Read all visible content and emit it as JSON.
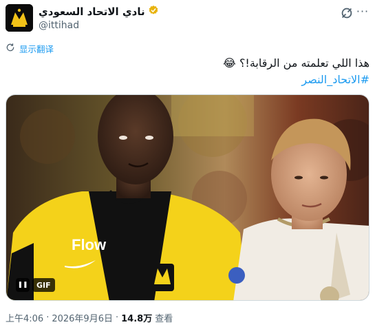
{
  "author": {
    "display_name": "نادي الاتحاد السعودي",
    "handle": "@ittihad",
    "verified": true,
    "verified_color": "#e8b30e"
  },
  "translate": {
    "label": "显示翻译"
  },
  "tweet": {
    "text": "هذا اللي تعلمته من الرقابة!؟ 😂",
    "hashtag": "#الاتحاد_النصر"
  },
  "media": {
    "type": "GIF",
    "badge": "GIF",
    "pause_icon": "pause-icon",
    "jersey_sponsor": "Flow"
  },
  "meta": {
    "time": "上午4:06",
    "separator": "·",
    "date": "2026年9月6日",
    "views_count": "14.8万",
    "views_label": "查看"
  },
  "colors": {
    "link": "#1d9bf0",
    "secondary_text": "#536471",
    "primary_text": "#0f1419"
  }
}
